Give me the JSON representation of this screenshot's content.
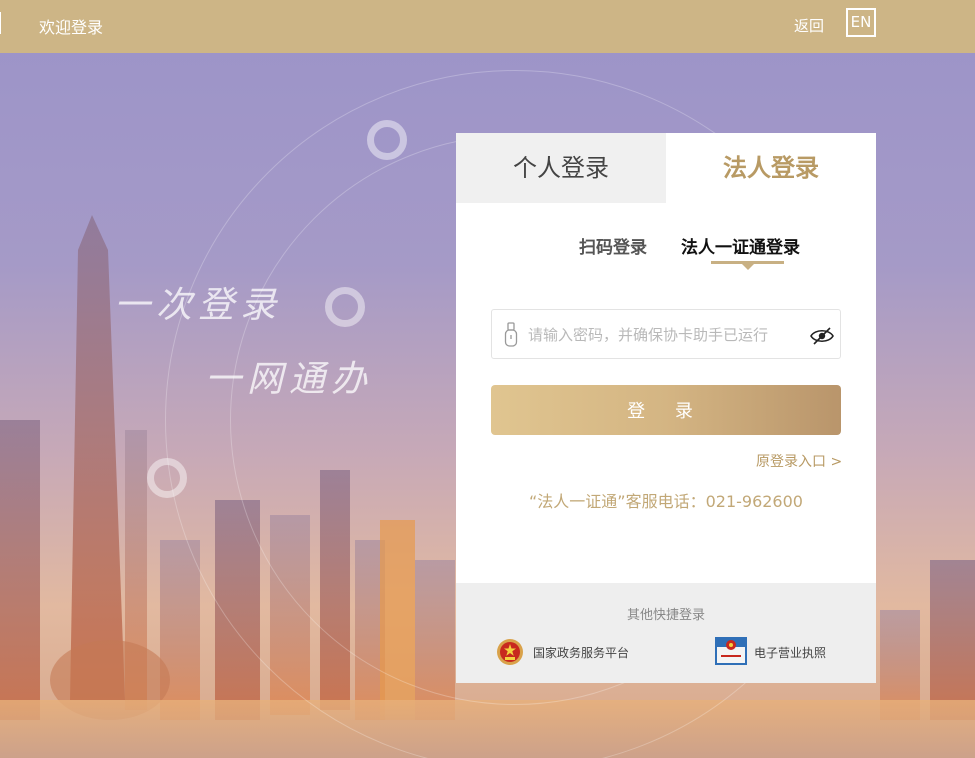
{
  "header": {
    "title": "欢迎登录",
    "back_label": "返回",
    "lang_label": "EN"
  },
  "background": {
    "slogan_line1": "一次登录",
    "slogan_line2": "一网通办"
  },
  "login": {
    "tabs": {
      "personal": "个人登录",
      "corporate": "法人登录"
    },
    "subtabs": {
      "qr": "扫码登录",
      "cert": "法人一证通登录"
    },
    "password_placeholder": "请输入密码，并确保协卡助手已运行",
    "password_value": "",
    "submit_label": "登 录",
    "old_entry_label": "原登录入口 >",
    "hotline": "“法人一证通”客服电话：021-962600"
  },
  "quick_login": {
    "title": "其他快捷登录",
    "items": [
      {
        "label": "国家政务服务平台",
        "icon": "national-emblem-icon"
      },
      {
        "label": "电子营业执照",
        "icon": "business-license-icon"
      }
    ]
  },
  "colors": {
    "header_bg": "#cdb586",
    "accent_gold": "#b89a64",
    "button_gradient_start": "#e0c590",
    "button_gradient_end": "#b9956b"
  }
}
